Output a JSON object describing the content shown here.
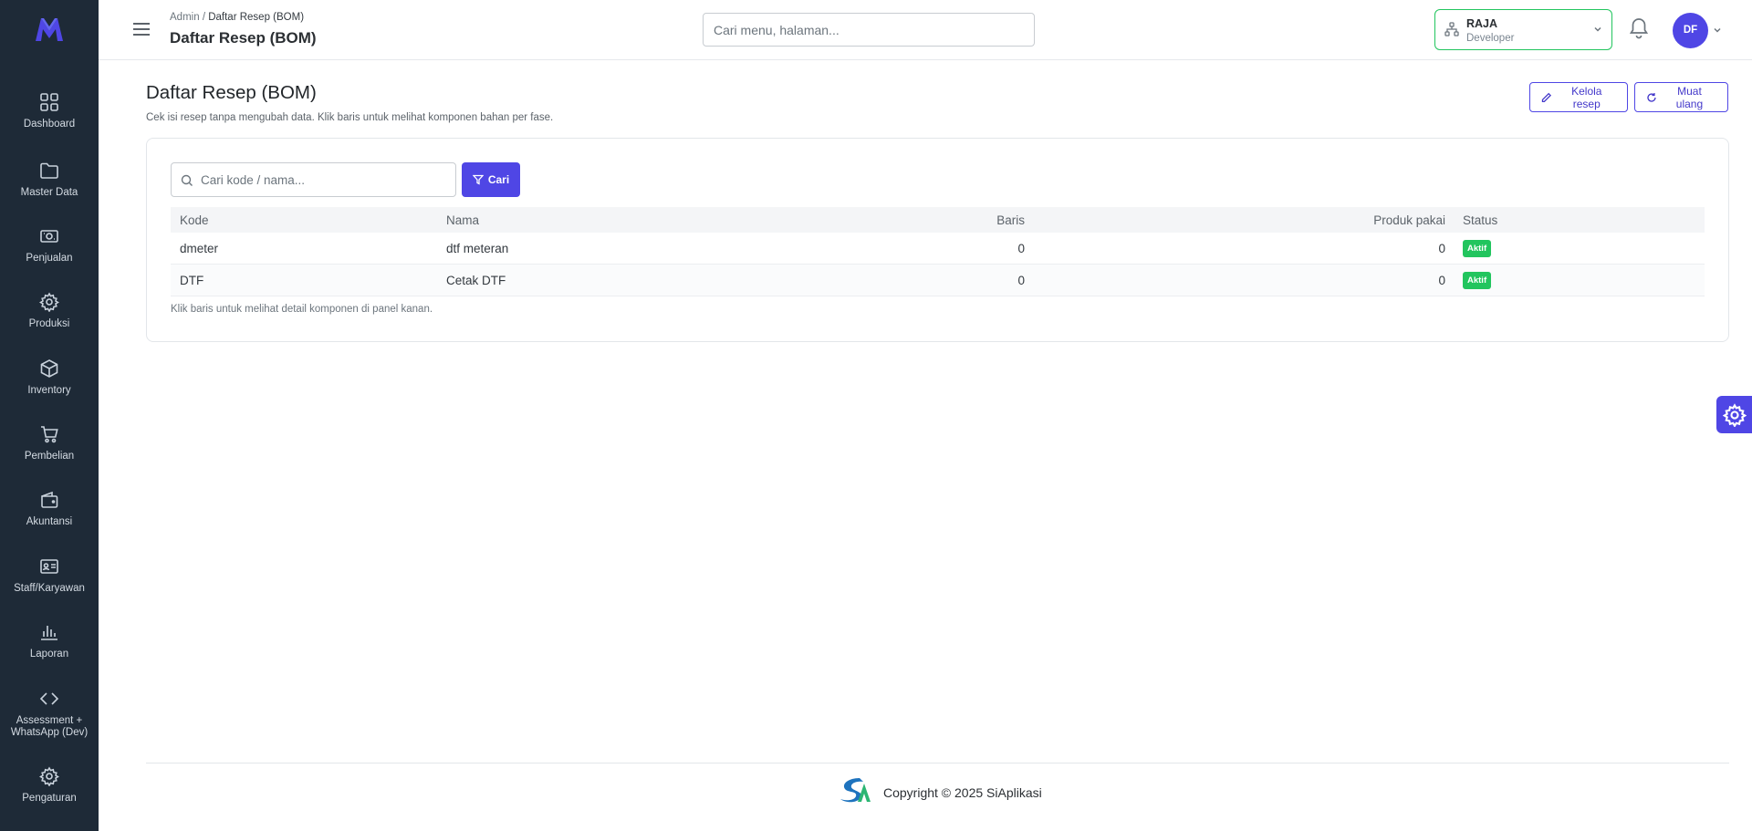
{
  "colors": {
    "sidebar_bg": "#1e2a37",
    "accent": "#4f46e5",
    "success": "#22c55e",
    "tenant_border": "#22c55e"
  },
  "sidebar": {
    "items": [
      {
        "label": "Dashboard",
        "icon": "grid-icon"
      },
      {
        "label": "Master Data",
        "icon": "folder-icon"
      },
      {
        "label": "Penjualan",
        "icon": "cash-icon"
      },
      {
        "label": "Produksi",
        "icon": "gear-icon"
      },
      {
        "label": "Inventory",
        "icon": "box-icon"
      },
      {
        "label": "Pembelian",
        "icon": "cart-icon"
      },
      {
        "label": "Akuntansi",
        "icon": "wallet-icon"
      },
      {
        "label": "Staff/Karyawan",
        "icon": "id-card-icon"
      },
      {
        "label": "Laporan",
        "icon": "bar-chart-icon"
      },
      {
        "label": "Assessment + WhatsApp (Dev)",
        "icon": "code-icon"
      },
      {
        "label": "Pengaturan",
        "icon": "gear-icon"
      }
    ]
  },
  "header": {
    "breadcrumb_root": "Admin",
    "breadcrumb_sep": "/",
    "breadcrumb_current": "Daftar Resep (BOM)",
    "title": "Daftar Resep (BOM)",
    "search_placeholder": "Cari menu, halaman...",
    "tenant_name": "RAJA",
    "tenant_role": "Developer",
    "avatar_initials": "DF"
  },
  "main": {
    "title": "Daftar Resep (BOM)",
    "subtitle": "Cek isi resep tanpa mengubah data. Klik baris untuk melihat komponen bahan per fase.",
    "edit_button": "Kelola resep",
    "reload_button": "Muat ulang",
    "search_placeholder": "Cari kode / nama...",
    "search_button": "Cari",
    "columns": {
      "kode": "Kode",
      "nama": "Nama",
      "baris": "Baris",
      "produk": "Produk pakai",
      "status": "Status"
    },
    "rows": [
      {
        "kode": "dmeter",
        "nama": "dtf meteran",
        "baris": "0",
        "produk": "0",
        "status": "Aktif"
      },
      {
        "kode": "DTF",
        "nama": "Cetak DTF",
        "baris": "0",
        "produk": "0",
        "status": "Aktif"
      }
    ],
    "note": "Klik baris untuk melihat detail komponen di panel kanan."
  },
  "footer": {
    "copyright": "Copyright © 2025 SiAplikasi"
  }
}
